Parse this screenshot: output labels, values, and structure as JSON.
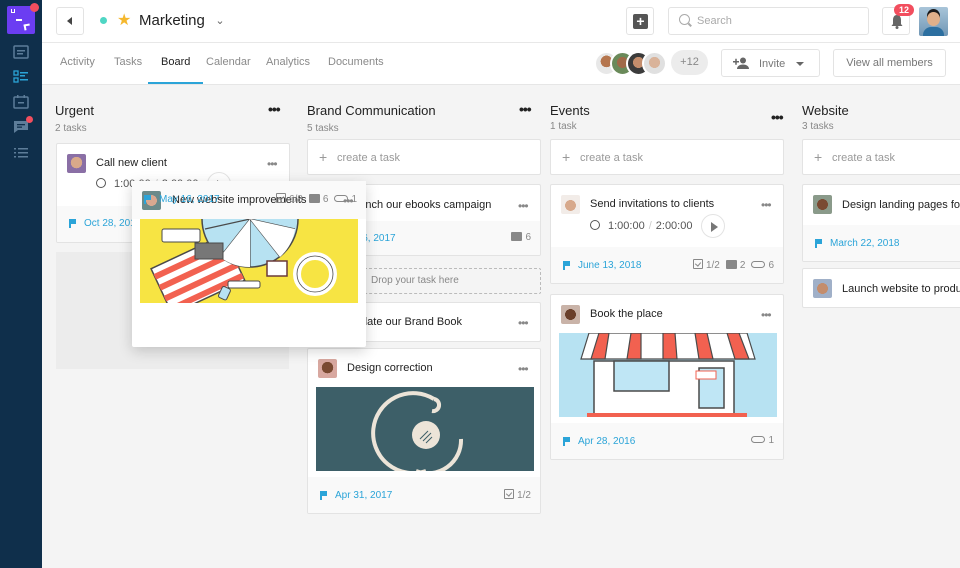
{
  "sidebar": {
    "items": [
      {
        "name": "logo",
        "badge": true
      },
      {
        "name": "messages-icon"
      },
      {
        "name": "board-icon",
        "active": true
      },
      {
        "name": "calendar-icon"
      },
      {
        "name": "chat-icon",
        "badge": true
      },
      {
        "name": "list-icon"
      }
    ]
  },
  "header": {
    "title": "Marketing",
    "search_placeholder": "Search",
    "notification_count": "12"
  },
  "tabs": [
    {
      "label": "Activity"
    },
    {
      "label": "Tasks"
    },
    {
      "label": "Board",
      "active": true
    },
    {
      "label": "Calendar"
    },
    {
      "label": "Analytics"
    },
    {
      "label": "Documents"
    }
  ],
  "members": {
    "more_label": "+12",
    "invite_label": "Invite",
    "view_all_label": "View all members"
  },
  "colors": {
    "accent": "#2ba4d8",
    "sidebar": "#0f2f4b",
    "logo": "#6b3df2",
    "badge": "#f24e5e",
    "star": "#f5b82e",
    "status": "#4fd6c4"
  },
  "create_task_label": "create a task",
  "drop_label": "Drop your task here",
  "columns": [
    {
      "title": "Urgent",
      "count": "2 tasks",
      "cards": [
        {
          "title": "Call new client",
          "timer_start": "1:00:00",
          "timer_total": "2:00:00",
          "date": "Oct 28, 2017"
        }
      ]
    },
    {
      "title": "Brand Communication",
      "count": "5 tasks",
      "cards": [
        {
          "title": "Launch our ebooks campaign",
          "date": "May 16, 2017",
          "comments": "6"
        },
        {
          "title": "Update our Brand Book"
        },
        {
          "title": "Design correction",
          "date": "Apr 31, 2017",
          "checklist": "1/2"
        }
      ]
    },
    {
      "title": "Events",
      "count": "1 task",
      "cards": [
        {
          "title": "Send invitations to clients",
          "timer_start": "1:00:00",
          "timer_total": "2:00:00",
          "date": "June 13, 2018",
          "checklist": "1/2",
          "comments": "2",
          "attachments": "6"
        },
        {
          "title": "Book the place",
          "date": "Apr 28, 2016",
          "attachments": "1"
        }
      ]
    },
    {
      "title": "Website",
      "count": "3 tasks",
      "cards": [
        {
          "title": "Design landing pages for",
          "date": "March 22, 2018"
        },
        {
          "title": "Launch website to produ"
        }
      ]
    }
  ],
  "dragging_card": {
    "title": "New website improvements",
    "date": "May 16, 2017",
    "checklist": "6/8",
    "comments": "6",
    "attachments": "1"
  }
}
